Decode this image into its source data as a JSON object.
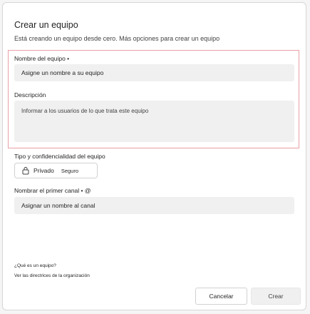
{
  "dialog": {
    "title": "Crear un equipo",
    "subtitle": "Está creando un equipo desde cero. Más opciones para crear un equipo"
  },
  "team_name": {
    "label": "Nombre del equipo •",
    "placeholder": "Asigne un nombre a su equipo"
  },
  "description": {
    "label": "Descripción",
    "placeholder": "Informar a los usuarios de lo que trata este equipo"
  },
  "privacy": {
    "label": "Tipo y confidencialidad del equipo",
    "value": "Privado",
    "sublabel": "Seguro",
    "icon": "lock-icon"
  },
  "channel": {
    "label": "Nombrar el primer canal • @",
    "placeholder": "Asignar un nombre al canal"
  },
  "links": {
    "what_is_team": "¿Qué es un equipo?",
    "org_guidelines": "Ver las directrices de la organización"
  },
  "buttons": {
    "cancel": "Cancelar",
    "create": "Crear"
  },
  "colors": {
    "highlight_border": "#e8a0a6",
    "field_background": "#f0f0f0"
  }
}
